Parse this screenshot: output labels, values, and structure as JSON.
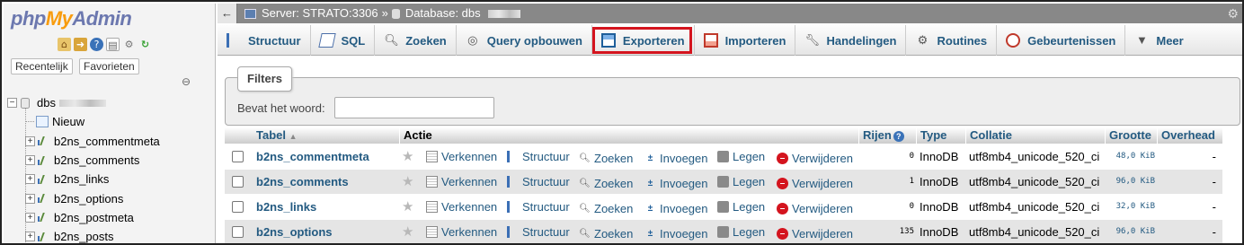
{
  "app": {
    "logo_php": "php",
    "logo_my": "My",
    "logo_admin": "Admin"
  },
  "left_panel": {
    "tabs": [
      "Recentelijk",
      "Favorieten"
    ],
    "icons": [
      "home-icon",
      "exit-icon",
      "help-icon",
      "docs-icon",
      "settings-icon",
      "reload-icon"
    ],
    "tree": {
      "database": "dbs",
      "new_label": "Nieuw",
      "tables": [
        "b2ns_commentmeta",
        "b2ns_comments",
        "b2ns_links",
        "b2ns_options",
        "b2ns_postmeta",
        "b2ns_posts"
      ]
    }
  },
  "breadcrumb": {
    "server": "Server: STRATO:3306",
    "separator": "»",
    "database": "Database: dbs"
  },
  "menu": {
    "tabs": [
      {
        "label": "Structuur",
        "icon": "structure-icon"
      },
      {
        "label": "SQL",
        "icon": "sql-icon"
      },
      {
        "label": "Zoeken",
        "icon": "search-icon"
      },
      {
        "label": "Query opbouwen",
        "icon": "query-icon"
      },
      {
        "label": "Exporteren",
        "icon": "export-icon"
      },
      {
        "label": "Importeren",
        "icon": "import-icon"
      },
      {
        "label": "Handelingen",
        "icon": "wrench-icon"
      },
      {
        "label": "Routines",
        "icon": "routines-icon"
      },
      {
        "label": "Gebeurtenissen",
        "icon": "clock-icon"
      },
      {
        "label": "Meer",
        "icon": "chevron-down-icon"
      }
    ],
    "highlighted": "Exporteren",
    "highlight_color": "#d4141e"
  },
  "filters": {
    "legend": "Filters",
    "label": "Bevat het woord:",
    "value": ""
  },
  "table": {
    "headers": {
      "table": "Tabel",
      "sort_indicator": "▲",
      "action": "Actie",
      "rows": "Rijen",
      "type": "Type",
      "collation": "Collatie",
      "size": "Grootte",
      "overhead": "Overhead"
    },
    "actions": [
      "Verkennen",
      "Structuur",
      "Zoeken",
      "Invoegen",
      "Legen",
      "Verwijderen"
    ],
    "rows": [
      {
        "name": "b2ns_commentmeta",
        "rows": "0",
        "type": "InnoDB",
        "collation": "utf8mb4_unicode_520_ci",
        "size": "48,0 KiB",
        "overhead": "-"
      },
      {
        "name": "b2ns_comments",
        "rows": "1",
        "type": "InnoDB",
        "collation": "utf8mb4_unicode_520_ci",
        "size": "96,0 KiB",
        "overhead": "-"
      },
      {
        "name": "b2ns_links",
        "rows": "0",
        "type": "InnoDB",
        "collation": "utf8mb4_unicode_520_ci",
        "size": "32,0 KiB",
        "overhead": "-"
      },
      {
        "name": "b2ns_options",
        "rows": "135",
        "type": "InnoDB",
        "collation": "utf8mb4_unicode_520_ci",
        "size": "96,0 KiB",
        "overhead": "-"
      }
    ]
  }
}
